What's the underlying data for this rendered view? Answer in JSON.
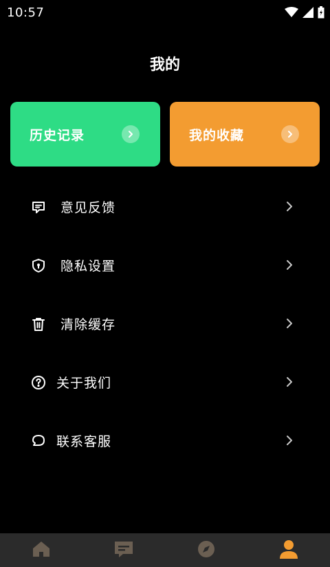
{
  "status_bar": {
    "time": "10:57",
    "icons": [
      "wifi-icon",
      "signal-icon",
      "battery-icon"
    ]
  },
  "header": {
    "title": "我的"
  },
  "cards": [
    {
      "id": "history",
      "label": "历史记录",
      "color": "#2edc85",
      "icon": "chevron-right-icon"
    },
    {
      "id": "favorites",
      "label": "我的收藏",
      "color": "#f39c31",
      "icon": "chevron-right-icon"
    }
  ],
  "menu": {
    "items": [
      {
        "id": "feedback",
        "label": "意见反馈",
        "icon": "message-square-icon"
      },
      {
        "id": "privacy",
        "label": "隐私设置",
        "icon": "shield-icon"
      },
      {
        "id": "clear-cache",
        "label": "清除缓存",
        "icon": "trash-icon"
      },
      {
        "id": "about",
        "label": "关于我们",
        "icon": "question-circle-icon"
      },
      {
        "id": "support",
        "label": "联系客服",
        "icon": "chat-bubble-icon"
      }
    ]
  },
  "bottom_nav": {
    "items": [
      {
        "id": "home",
        "icon": "home-icon",
        "active": false
      },
      {
        "id": "messages",
        "icon": "message-icon",
        "active": false
      },
      {
        "id": "discover",
        "icon": "compass-icon",
        "active": false
      },
      {
        "id": "profile",
        "icon": "user-icon",
        "active": true
      }
    ],
    "active_color": "#f39c31",
    "inactive_color": "#6b5f52"
  }
}
